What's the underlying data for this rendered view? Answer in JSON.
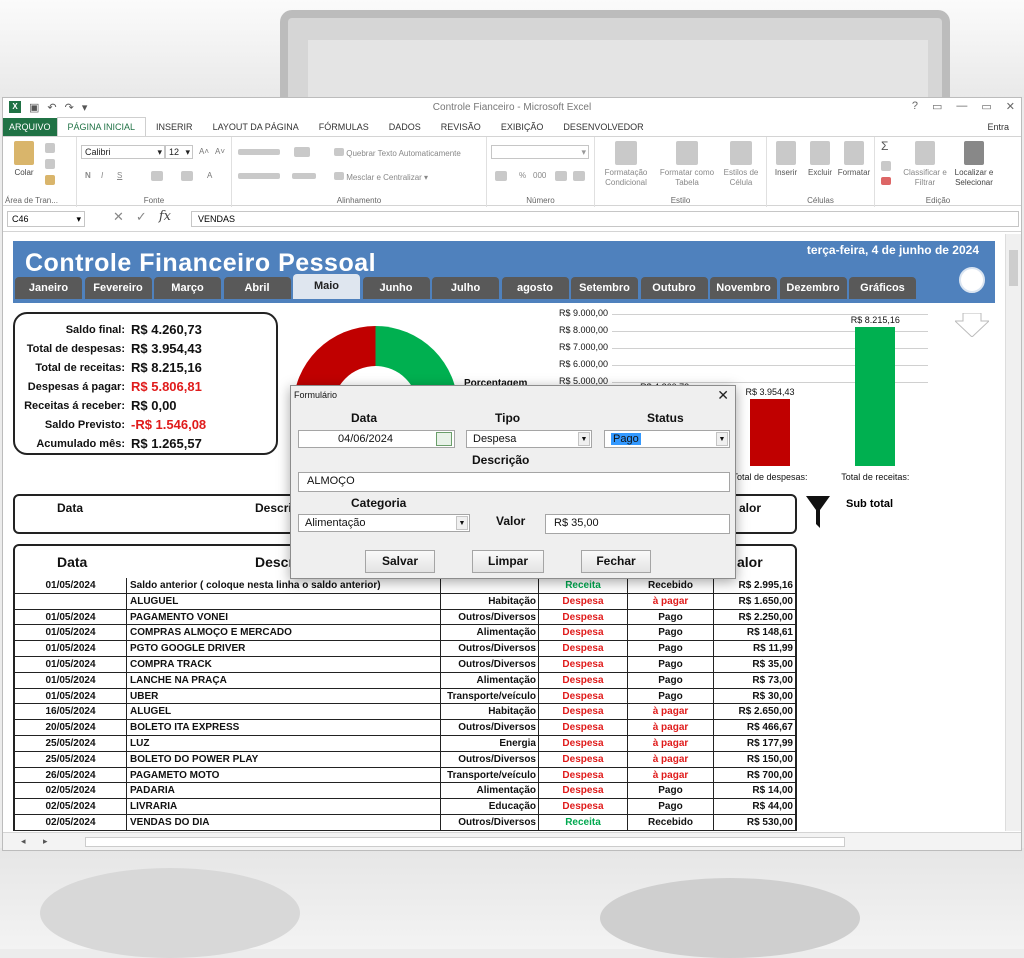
{
  "excel": {
    "window_title": "Controle Fianceiro - Microsoft Excel",
    "window_controls": [
      "?",
      "▭",
      "—",
      "▭",
      "✕"
    ],
    "ribbon_tabs": [
      "ARQUIVO",
      "PÁGINA INICIAL",
      "INSERIR",
      "LAYOUT DA PÁGINA",
      "FÓRMULAS",
      "DADOS",
      "REVISÃO",
      "EXIBIÇÃO",
      "DESENVOLVEDOR"
    ],
    "ribbon_tab_right": "Entra",
    "ribbon": {
      "paste": "Colar",
      "clipboard_group": "Área de Tran...",
      "font_name": "Calibri",
      "font_size": "12",
      "font_group": "Fonte",
      "wrap_text": "Quebrar Texto Automaticamente",
      "merge_center": "Mesclar e Centralizar",
      "alignment_group": "Alinhamento",
      "number_group": "Número",
      "cond_format": "Formatação Condicional",
      "format_table": "Formatar como Tabela",
      "cell_styles": "Estilos de Célula",
      "style_group": "Estilo",
      "insert": "Inserir",
      "delete": "Excluir",
      "format": "Formatar",
      "cells_group": "Células",
      "sort_filter": "Classificar e Filtrar",
      "find_select": "Localizar e Selecionar",
      "editing_group": "Edição",
      "bold": "N",
      "italic": "I",
      "underline": "S",
      "percent": "%",
      "thousands": "000"
    },
    "name_box": "C46",
    "formula_value": "VENDAS"
  },
  "sheet": {
    "title": "Controle Financeiro Pessoal",
    "date": "terça-feira, 4 de junho de 2024",
    "months": [
      "Janeiro",
      "Fevereiro",
      "Março",
      "Abril",
      "Maio",
      "Junho",
      "Julho",
      "agosto",
      "Setembro",
      "Outubro",
      "Novembro",
      "Dezembro",
      "Gráficos"
    ],
    "active_month": "Maio",
    "summary": [
      {
        "label": "Saldo final:",
        "value": "R$ 4.260,73",
        "color": "#111111"
      },
      {
        "label": "Total de despesas:",
        "value": "R$ 3.954,43",
        "color": "#111111"
      },
      {
        "label": "Total de receitas:",
        "value": "R$ 8.215,16",
        "color": "#111111"
      },
      {
        "label": "Despesas á pagar:",
        "value": "R$ 5.806,81",
        "color": "#e01b1b"
      },
      {
        "label": "Receitas á receber:",
        "value": "R$ 0,00",
        "color": "#111111"
      },
      {
        "label": "Saldo Previsto:",
        "value": "-R$ 1.546,08",
        "color": "#e01b1b"
      },
      {
        "label": "Acumulado mês:",
        "value": "R$ 1.265,57",
        "color": "#111111"
      }
    ],
    "donut_label": "Porcentagem",
    "filter_headers": {
      "data": "Data",
      "descricao": "Descri",
      "valor": "alor"
    },
    "subtotal_label": "Sub total",
    "table_headers": {
      "data": "Data",
      "descricao": "Descr",
      "valor": "alor"
    },
    "rows": [
      [
        "01/05/2024",
        "Saldo anterior ( coloque nesta linha o saldo anterior)",
        "",
        "Receita",
        "Recebido",
        "R$ 2.995,16"
      ],
      [
        "",
        "ALUGUEL",
        "Habitação",
        "Despesa",
        "à pagar",
        "R$ 1.650,00"
      ],
      [
        "01/05/2024",
        "PAGAMENTO VONEI",
        "Outros/Diversos",
        "Despesa",
        "Pago",
        "R$ 2.250,00"
      ],
      [
        "01/05/2024",
        "COMPRAS ALMOÇO E MERCADO",
        "Alimentação",
        "Despesa",
        "Pago",
        "R$ 148,61"
      ],
      [
        "01/05/2024",
        "PGTO GOOGLE DRIVER",
        "Outros/Diversos",
        "Despesa",
        "Pago",
        "R$ 11,99"
      ],
      [
        "01/05/2024",
        "COMPRA TRACK",
        "Outros/Diversos",
        "Despesa",
        "Pago",
        "R$ 35,00"
      ],
      [
        "01/05/2024",
        "LANCHE NA PRAÇA",
        "Alimentação",
        "Despesa",
        "Pago",
        "R$ 73,00"
      ],
      [
        "01/05/2024",
        "UBER",
        "Transporte/veículo",
        "Despesa",
        "Pago",
        "R$ 30,00"
      ],
      [
        "16/05/2024",
        "ALUGEL",
        "Habitação",
        "Despesa",
        "à pagar",
        "R$ 2.650,00"
      ],
      [
        "20/05/2024",
        "BOLETO ITA EXPRESS",
        "Outros/Diversos",
        "Despesa",
        "à pagar",
        "R$ 466,67"
      ],
      [
        "25/05/2024",
        "LUZ",
        "Energia",
        "Despesa",
        "à pagar",
        "R$ 177,99"
      ],
      [
        "25/05/2024",
        "BOLETO DO POWER PLAY",
        "Outros/Diversos",
        "Despesa",
        "à pagar",
        "R$ 150,00"
      ],
      [
        "26/05/2024",
        "PAGAMETO MOTO",
        "Transporte/veículo",
        "Despesa",
        "à pagar",
        "R$ 700,00"
      ],
      [
        "02/05/2024",
        "PADARIA",
        "Alimentação",
        "Despesa",
        "Pago",
        "R$ 14,00"
      ],
      [
        "02/05/2024",
        "LIVRARIA",
        "Educação",
        "Despesa",
        "Pago",
        "R$ 44,00"
      ],
      [
        "02/05/2024",
        "VENDAS DO DIA",
        "Outros/Diversos",
        "Receita",
        "Recebido",
        "R$ 530,00"
      ]
    ]
  },
  "chart_data": [
    {
      "type": "pie",
      "title": "",
      "categories": [
        "",
        ""
      ],
      "values": [
        50,
        50
      ],
      "colors": [
        "#00b050",
        "#c00000"
      ],
      "donut": true
    },
    {
      "type": "bar",
      "title": "",
      "categories": [
        "",
        "Total de despesas:",
        "Total de receitas:"
      ],
      "values": [
        4260.73,
        3954.43,
        8215.16
      ],
      "data_labels": [
        "R$ 4.260,73",
        "R$ 3.954,43",
        "R$ 8.215,16"
      ],
      "colors": [
        "#c00000",
        "#c00000",
        "#00b050"
      ],
      "ylim": [
        0,
        9000
      ],
      "yticks": [
        "R$ 9.000,00",
        "R$ 8.000,00",
        "R$ 7.000,00",
        "R$ 6.000,00",
        "R$ 5.000,00"
      ],
      "grid": true
    }
  ],
  "dialog": {
    "title": "Formulário",
    "close": "✕",
    "data_label": "Data",
    "data_value": "04/06/2024",
    "tipo_label": "Tipo",
    "tipo_value": "Despesa",
    "status_label": "Status",
    "status_value": "Pago",
    "descricao_label": "Descrição",
    "descricao_value": "ALMOÇO",
    "categoria_label": "Categoria",
    "categoria_value": "Alimentação",
    "valor_label": "Valor",
    "valor_value": "R$ 35,00",
    "save": "Salvar",
    "clear": "Limpar",
    "close_button": "Fechar"
  }
}
